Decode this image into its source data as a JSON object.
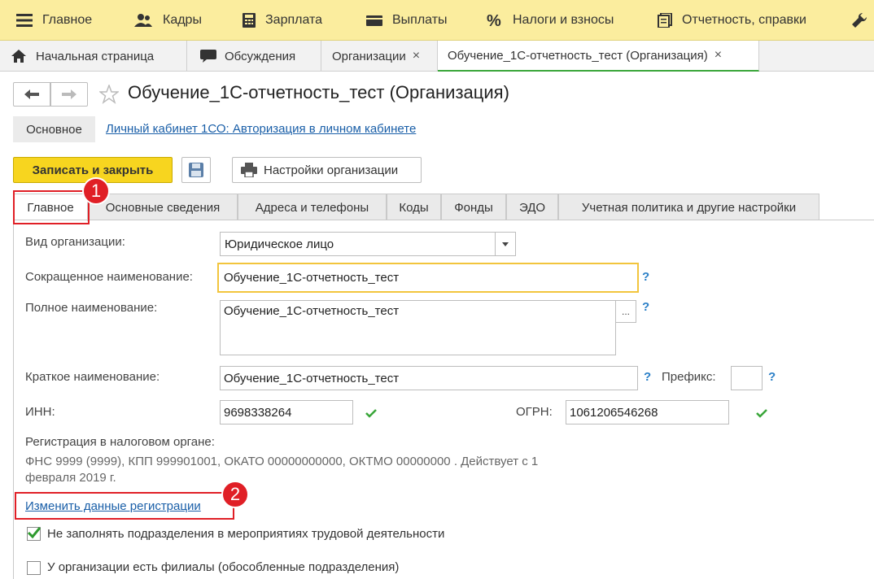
{
  "menu": [
    {
      "label": "Главное",
      "icon": "hamburger-icon"
    },
    {
      "label": "Кадры",
      "icon": "users-icon"
    },
    {
      "label": "Зарплата",
      "icon": "calculator-icon"
    },
    {
      "label": "Выплаты",
      "icon": "wallet-icon"
    },
    {
      "label": "Налоги и взносы",
      "icon": "percent-icon"
    },
    {
      "label": "Отчетность, справки",
      "icon": "reports-icon"
    },
    {
      "label": "",
      "icon": "wrench-icon"
    }
  ],
  "open_tabs": [
    {
      "label": "Начальная страница",
      "icon": "home-icon"
    },
    {
      "label": "Обсуждения",
      "icon": "chat-icon"
    },
    {
      "label": "Организации",
      "close": "×"
    },
    {
      "label": "Обучение_1С-отчетность_тест (Организация)",
      "close": "×"
    }
  ],
  "form": {
    "title": "Обучение_1С-отчетность_тест (Организация)",
    "nav_main": "Основное",
    "nav_link": "Личный кабинет 1СО: Авторизация в личном кабинете",
    "save_close": "Записать и закрыть",
    "settings": "Настройки организации"
  },
  "tabs": [
    "Главное",
    "Основные сведения",
    "Адреса и телефоны",
    "Коды",
    "Фонды",
    "ЭДО",
    "Учетная политика и другие настройки"
  ],
  "fields": {
    "org_type_label": "Вид организации:",
    "org_type_value": "Юридическое лицо",
    "short_name_label": "Сокращенное наименование:",
    "short_name_value": "Обучение_1С-отчетность_тест",
    "full_name_label": "Полное наименование:",
    "full_name_value": "Обучение_1С-отчетность_тест",
    "brief_name_label": "Краткое наименование:",
    "brief_name_value": "Обучение_1С-отчетность_тест",
    "prefix_label": "Префикс:",
    "prefix_value": "",
    "inn_label": "ИНН:",
    "inn_value": "9698338264",
    "ogrn_label": "ОГРН:",
    "ogrn_value": "1061206546268",
    "help": "?",
    "ellipsis": "..."
  },
  "registration": {
    "label": "Регистрация в налоговом органе:",
    "line1": "ФНС 9999 (9999), КПП 999901001, ОКАТО 00000000000, ОКТМО 00000000   . Действует с 1",
    "line2": "февраля 2019 г.",
    "change_link": "Изменить данные регистрации"
  },
  "checkboxes": [
    {
      "label": "Не заполнять подразделения в мероприятиях трудовой деятельности",
      "checked": true
    },
    {
      "label": "У организации есть филиалы (обособленные подразделения)",
      "checked": false
    }
  ],
  "badges": [
    "1",
    "2"
  ],
  "colors": {
    "accent": "#f7d51f",
    "topbar": "#fbed9e",
    "highlight": "#e01f26",
    "link": "#1a5fa8",
    "check": "#3aa63a"
  }
}
